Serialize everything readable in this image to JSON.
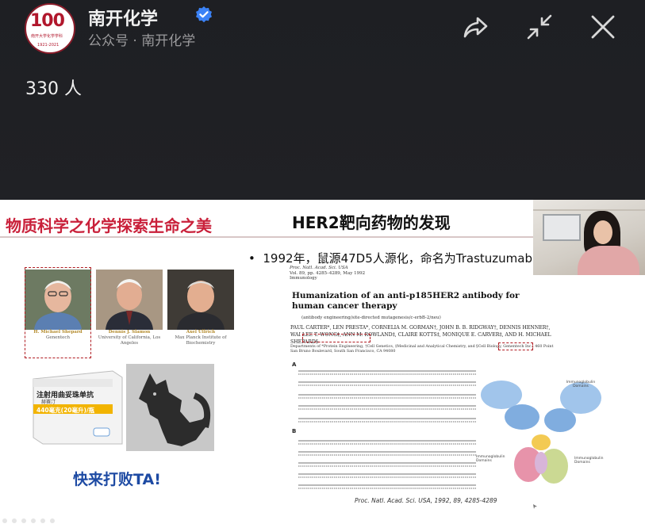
{
  "header": {
    "account_name": "南开化学",
    "account_subtitle": "公众号 · 南开化学",
    "viewer_count": "330 人",
    "avatar": {
      "big_text": "100",
      "subtitle": "南开大学化学学科",
      "years": "1921-2021"
    }
  },
  "icons": [
    "verified-icon",
    "share-icon",
    "minimize-icon",
    "close-icon"
  ],
  "slide": {
    "left_title": "物质科学之化学探索生命之美",
    "main_title": "HER2靶向药物的发现",
    "bullet": "1992年，鼠源47D5人源化，命名为Trastuzumab",
    "scientists": [
      {
        "name": "H. Michael Shepard",
        "affiliation": "Genentech"
      },
      {
        "name": "Dennis J. Slamon",
        "affiliation": "University of California, Los Angeles"
      },
      {
        "name": "Axel Ullrich",
        "affiliation": "Max Planck Institute of Biochemistry"
      }
    ],
    "drug_box": {
      "name": "注射用曲妥珠单抗",
      "brand": "赫赛汀",
      "dose": "440毫克(20毫升)/瓶"
    },
    "call_to_action": "快来打败TA!",
    "paper": {
      "journal": "Proc. Natl. Acad. Sci. USA",
      "volume": "Vol. 89, pp. 4285–4289, May 1992",
      "section": "Immunology",
      "title": "Humanization of an anti-p185HER2 antibody for human cancer therapy",
      "subtitle": "(antibody engineering/site-directed mutagenesis/c-erbB-2/neu)",
      "authors": "PAUL CARTER*, LEN PRESTA*, CORNELIA M. GORMAN†, JOHN B. B. RIDGWAY†, DENNIS HENNER†, WAI LEE T. WONG‡, ANN M. ROWLAND‡, CLAIRE KOTTS‡, MONIQUE E. CARVER‡, AND H. MICHAEL SHEPARD§",
      "affiliation": "Departments of *Protein Engineering, †Cell Genetics, ‡Medicinal and Analytical Chemistry, and §Cell Biology, Genentech Inc., 460 Point San Bruno Boulevard, South San Francisco, CA 94080",
      "panel_a": "A",
      "panel_b": "B",
      "antibody_labels": [
        "Immunoglobulin Domains",
        "Immunoglobulin Domains",
        "Immunoglobulin Domains"
      ]
    },
    "citation": "Proc. Natl. Acad. Sci. USA, 1992, 89, 4285-4289"
  },
  "colors": {
    "accent_red": "#c9203a",
    "call_blue": "#1d4aa3",
    "header_bg": "#1e1f23",
    "verified_blue": "#3b82f6"
  }
}
